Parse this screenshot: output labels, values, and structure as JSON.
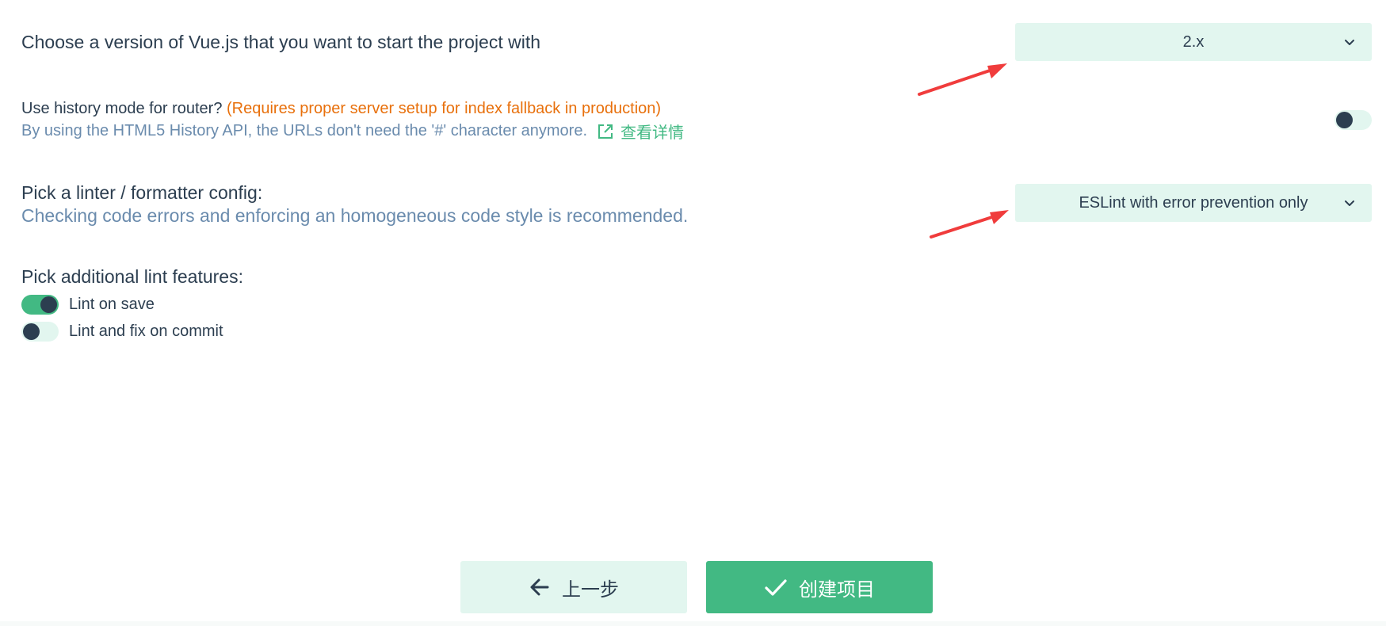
{
  "vue_version": {
    "label": "Choose a version of Vue.js that you want to start the project with",
    "selected": "2.x",
    "icon": "chevron-down-icon"
  },
  "history_mode": {
    "label": "Use history mode for router?",
    "warning": "(Requires proper server setup for index fallback in production)",
    "description": "By using the HTML5 History API, the URLs don't need the '#' character anymore.",
    "link_text": "查看详情",
    "link_icon": "external-link-icon",
    "enabled": false
  },
  "linter": {
    "label": "Pick a linter / formatter config:",
    "description": "Checking code errors and enforcing an homogeneous code style is recommended.",
    "selected": "ESLint with error prevention only",
    "icon": "chevron-down-icon"
  },
  "lint_features": {
    "label": "Pick additional lint features:",
    "items": [
      {
        "label": "Lint on save",
        "enabled": true
      },
      {
        "label": "Lint and fix on commit",
        "enabled": false
      }
    ]
  },
  "footer": {
    "prev_label": "上一步",
    "prev_icon": "arrow-left-icon",
    "create_label": "创建项目",
    "create_icon": "check-icon"
  },
  "colors": {
    "accent": "#42b983",
    "accent_light": "#e2f6ef",
    "text": "#2c3e50",
    "description": "#6a8bad",
    "warning": "#e8700c",
    "annotation_arrow": "#f03c3c"
  }
}
